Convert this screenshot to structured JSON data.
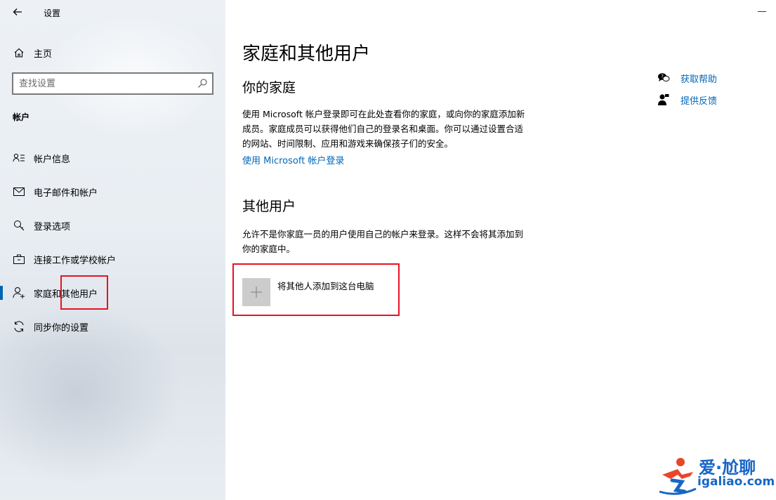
{
  "window": {
    "app_title": "设置"
  },
  "sidebar": {
    "home_label": "主页",
    "search_placeholder": "查找设置",
    "section_label": "帐户",
    "items": [
      {
        "label": "帐户信息",
        "icon": "account-info-icon"
      },
      {
        "label": "电子邮件和帐户",
        "icon": "mail-icon"
      },
      {
        "label": "登录选项",
        "icon": "key-icon"
      },
      {
        "label": "连接工作或学校帐户",
        "icon": "briefcase-icon"
      },
      {
        "label": "家庭和其他用户",
        "icon": "person-add-icon",
        "active": true
      },
      {
        "label": "同步你的设置",
        "icon": "sync-icon"
      }
    ]
  },
  "main": {
    "page_title": "家庭和其他用户",
    "family": {
      "heading": "你的家庭",
      "description_lines": [
        "使用 Microsoft 帐户登录即可在此处查看你的家庭，或向你的家庭添加新",
        "成员。家庭成员可以获得他们自己的登录名和桌面。你可以通过设置合适",
        "的网站、时间限制、应用和游戏来确保孩子们的安全。"
      ],
      "link": "使用 Microsoft 帐户登录"
    },
    "other_users": {
      "heading": "其他用户",
      "description_lines": [
        "允许不是你家庭一员的用户使用自己的帐户来登录。这样不会将其添加到",
        "你的家庭中。"
      ],
      "add_button_label": "将其他人添加到这台电脑"
    },
    "help": {
      "get_help": "获取帮助",
      "feedback": "提供反馈"
    }
  },
  "watermark": {
    "brand": "爱·尬聊",
    "url": "igaliao.com"
  },
  "colors": {
    "accent": "#0063b1",
    "link": "#0067b8",
    "highlight_box": "#e81123"
  }
}
